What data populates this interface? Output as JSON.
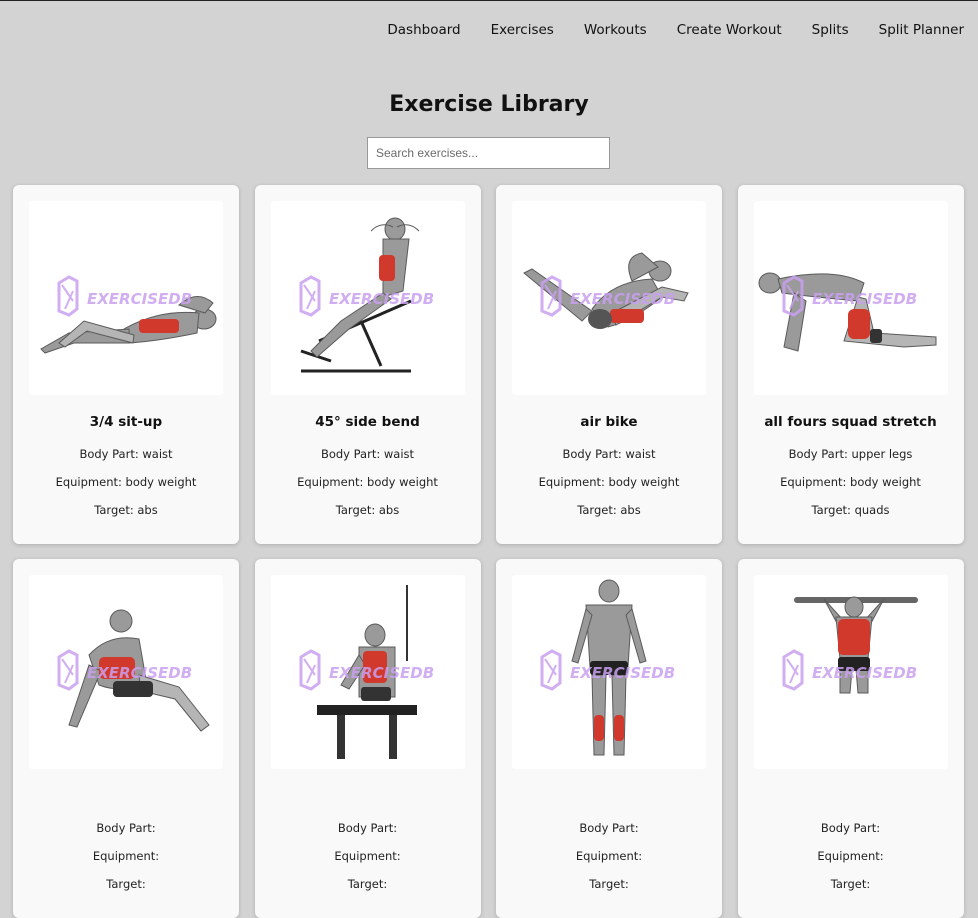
{
  "nav": {
    "items": [
      "Dashboard",
      "Exercises",
      "Workouts",
      "Create Workout",
      "Splits",
      "Split Planner"
    ]
  },
  "page": {
    "title": "Exercise Library",
    "search_placeholder": "Search exercises..."
  },
  "labels": {
    "body_part": "Body Part: ",
    "equipment": "Equipment: ",
    "target": "Target: "
  },
  "watermark": "EXERCISEDB",
  "colors": {
    "background": "#d3d3d3",
    "card": "#f9f9f9",
    "watermark": "#c9a0f0",
    "muscle": "#d0392b"
  },
  "exercises": [
    {
      "name": "3/4 sit-up",
      "body_part": "waist",
      "equipment": "body weight",
      "target": "abs",
      "pose": "situp"
    },
    {
      "name": "45° side bend",
      "body_part": "waist",
      "equipment": "body weight",
      "target": "abs",
      "pose": "bench"
    },
    {
      "name": "air bike",
      "body_part": "waist",
      "equipment": "body weight",
      "target": "abs",
      "pose": "bike"
    },
    {
      "name": "all fours squad stretch",
      "body_part": "upper legs",
      "equipment": "body weight",
      "target": "quads",
      "pose": "fours"
    },
    {
      "name": "",
      "body_part": "",
      "equipment": "",
      "target": "",
      "pose": "recline"
    },
    {
      "name": "",
      "body_part": "",
      "equipment": "",
      "target": "",
      "pose": "cable"
    },
    {
      "name": "",
      "body_part": "",
      "equipment": "",
      "target": "",
      "pose": "stand"
    },
    {
      "name": "",
      "body_part": "",
      "equipment": "",
      "target": "",
      "pose": "pullup"
    }
  ]
}
